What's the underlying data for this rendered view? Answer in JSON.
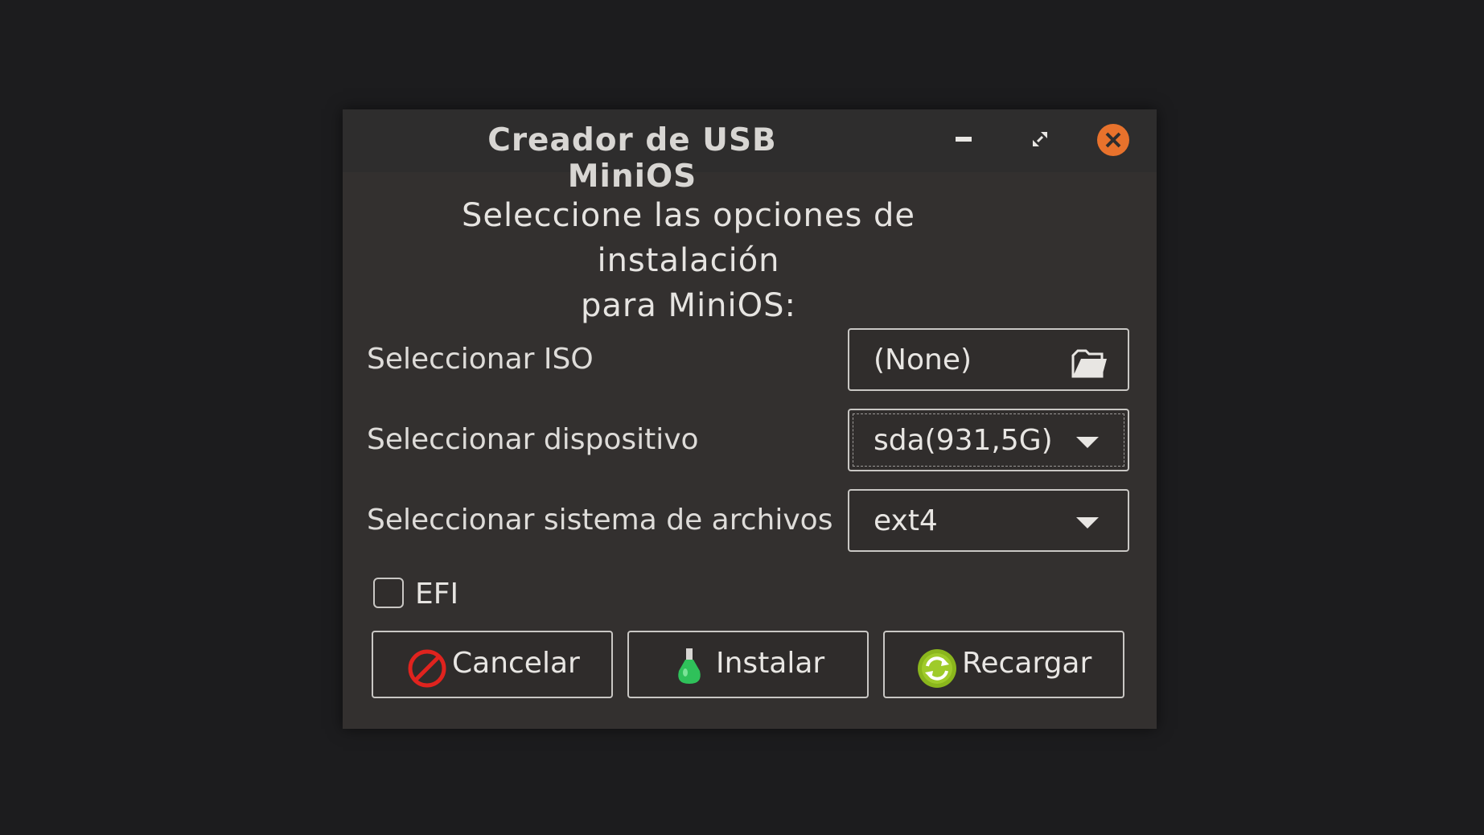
{
  "window": {
    "title": "Creador de USB MiniOS",
    "controls": {
      "minimize": "minimize-icon",
      "restore": "restore-icon",
      "close": "close-icon"
    }
  },
  "heading": {
    "line1": "Seleccione las opciones de instalación",
    "line2": "para MiniOS:"
  },
  "form": {
    "iso": {
      "label": "Seleccionar ISO",
      "value": "(None)",
      "icon": "folder-open-icon"
    },
    "device": {
      "label": "Seleccionar dispositivo",
      "value": "sda(931,5G)"
    },
    "filesystem": {
      "label": "Seleccionar sistema de archivos",
      "value": "ext4"
    },
    "efi": {
      "label": "EFI",
      "checked": false
    }
  },
  "buttons": {
    "cancel": {
      "label": "Cancelar",
      "icon": "cancel-icon",
      "color": "#e0231e"
    },
    "install": {
      "label": "Instalar",
      "icon": "flask-icon",
      "color": "#2fc15a"
    },
    "reload": {
      "label": "Recargar",
      "icon": "reload-icon",
      "color": "#8ab61c"
    }
  },
  "colors": {
    "close": "#e8722c"
  }
}
